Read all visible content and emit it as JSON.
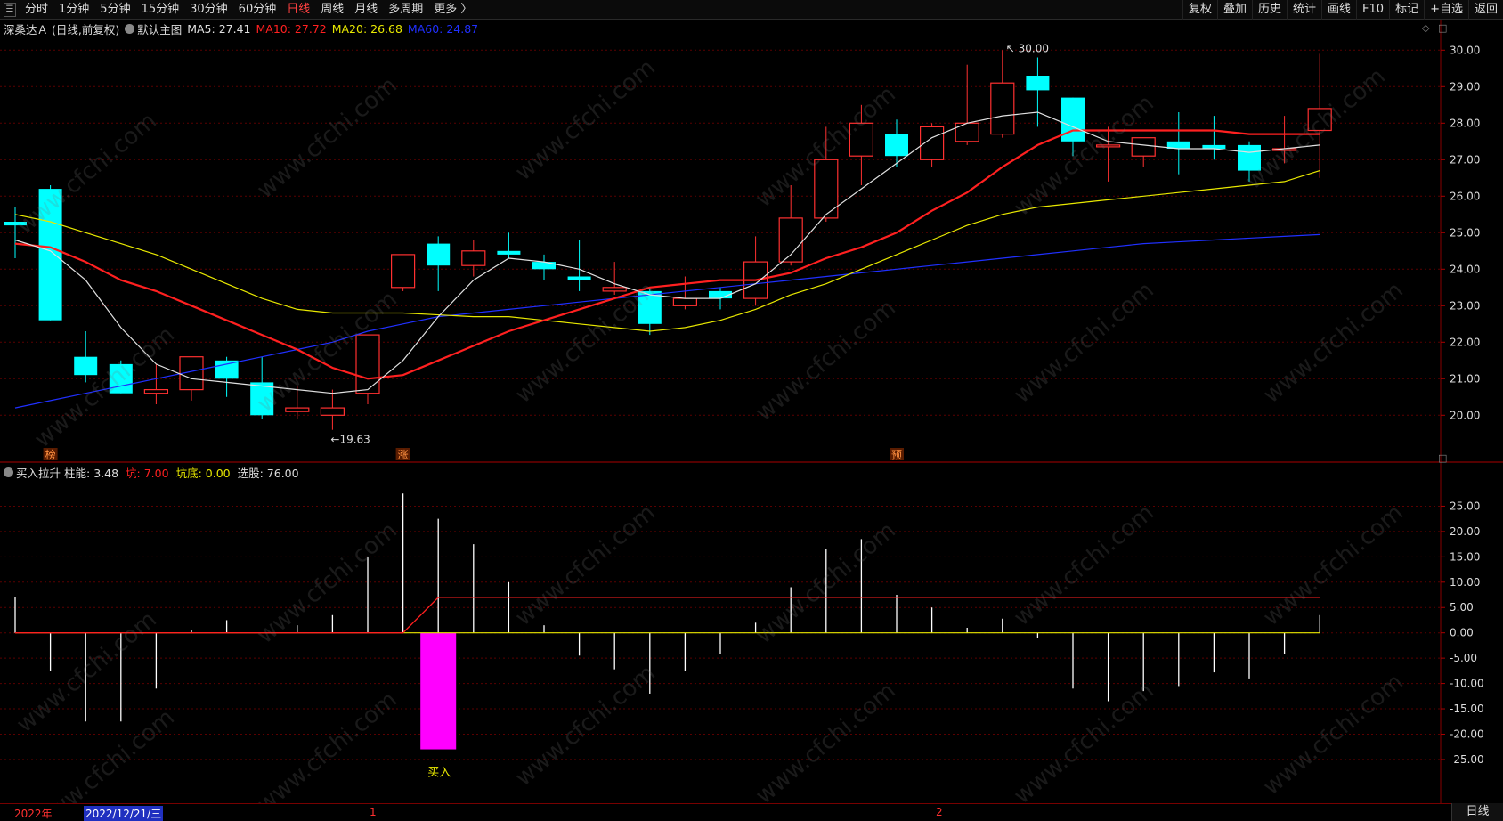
{
  "toolbar": {
    "menu_icon": "menu-icon",
    "periods": [
      "分时",
      "1分钟",
      "5分钟",
      "15分钟",
      "30分钟",
      "60分钟",
      "日线",
      "周线",
      "月线",
      "多周期",
      "更多 〉"
    ],
    "active_period": "日线",
    "right_buttons": [
      "复权",
      "叠加",
      "历史",
      "统计",
      "画线",
      "F10",
      "标记",
      "+自选",
      "返回"
    ]
  },
  "main_panel": {
    "stock": "深桑达Ａ (日线,前复权)",
    "template": "默认主图",
    "ma5_label": "MA5: 27.41",
    "ma10_label": "MA10: 27.72",
    "ma20_label": "MA20: 26.68",
    "ma60_label": "MA60: 24.87",
    "high_marker": "30.00",
    "low_marker": "19.63",
    "marks": [
      "榜",
      "涨",
      "预"
    ],
    "colors": {
      "up": "#ff3030",
      "down": "#00ffff",
      "ma5": "#e0e0e0",
      "ma10": "#ff2020",
      "ma20": "#e8e800",
      "ma60": "#2030ff"
    }
  },
  "sub_panel": {
    "indicator": "买入拉升",
    "zhuneng_label": "柱能: 3.48",
    "keng_label": "坑: 7.00",
    "kengdi_label": "坑底: 0.00",
    "xuangu_label": "选股: 76.00",
    "buy_label": "买入",
    "colors": {
      "bar": "#ffffff",
      "buy": "#ff00ff",
      "line_red": "#ff2020",
      "line_yellow": "#e8e800"
    }
  },
  "bottom": {
    "year_label": "2022年",
    "cursor_date": "2022/12/21/三",
    "month_labels": [
      "1",
      "2"
    ],
    "period_tag": "日线"
  },
  "watermark": "www.cfchi.com",
  "chart_data": [
    {
      "type": "candlestick",
      "yticks": [
        "30.00",
        "29.00",
        "28.00",
        "27.00",
        "26.00",
        "25.00",
        "24.00",
        "23.00",
        "22.00",
        "21.00",
        "20.00"
      ],
      "ylim": [
        19.3,
        30.3
      ],
      "candles": [
        {
          "o": 25.3,
          "h": 25.7,
          "l": 24.3,
          "c": 25.2
        },
        {
          "o": 26.2,
          "h": 26.3,
          "l": 22.6,
          "c": 22.6
        },
        {
          "o": 21.6,
          "h": 22.3,
          "l": 20.9,
          "c": 21.1
        },
        {
          "o": 21.4,
          "h": 21.5,
          "l": 20.6,
          "c": 20.6
        },
        {
          "o": 20.6,
          "h": 21.4,
          "l": 20.3,
          "c": 20.7
        },
        {
          "o": 20.7,
          "h": 21.6,
          "l": 20.4,
          "c": 21.6
        },
        {
          "o": 21.5,
          "h": 21.6,
          "l": 20.5,
          "c": 21.0
        },
        {
          "o": 20.9,
          "h": 21.6,
          "l": 19.9,
          "c": 20.0
        },
        {
          "o": 20.1,
          "h": 20.8,
          "l": 19.9,
          "c": 20.2
        },
        {
          "o": 20.0,
          "h": 20.7,
          "l": 19.6,
          "c": 20.2
        },
        {
          "o": 20.6,
          "h": 22.2,
          "l": 20.3,
          "c": 22.2
        },
        {
          "o": 23.5,
          "h": 24.4,
          "l": 23.4,
          "c": 24.4
        },
        {
          "o": 24.7,
          "h": 24.9,
          "l": 23.4,
          "c": 24.1
        },
        {
          "o": 24.1,
          "h": 24.8,
          "l": 23.8,
          "c": 24.5
        },
        {
          "o": 24.5,
          "h": 25.0,
          "l": 24.3,
          "c": 24.4
        },
        {
          "o": 24.2,
          "h": 24.4,
          "l": 23.7,
          "c": 24.0
        },
        {
          "o": 23.8,
          "h": 24.8,
          "l": 23.4,
          "c": 23.7
        },
        {
          "o": 23.4,
          "h": 24.2,
          "l": 23.3,
          "c": 23.5
        },
        {
          "o": 23.4,
          "h": 23.5,
          "l": 22.2,
          "c": 22.5
        },
        {
          "o": 23.0,
          "h": 23.8,
          "l": 22.9,
          "c": 23.2
        },
        {
          "o": 23.4,
          "h": 23.5,
          "l": 22.9,
          "c": 23.2
        },
        {
          "o": 23.2,
          "h": 24.9,
          "l": 23.0,
          "c": 24.2
        },
        {
          "o": 24.2,
          "h": 26.3,
          "l": 24.1,
          "c": 25.4
        },
        {
          "o": 25.4,
          "h": 27.9,
          "l": 25.3,
          "c": 27.0
        },
        {
          "o": 27.1,
          "h": 28.5,
          "l": 26.3,
          "c": 28.0
        },
        {
          "o": 27.7,
          "h": 28.1,
          "l": 26.8,
          "c": 27.1
        },
        {
          "o": 27.0,
          "h": 28.0,
          "l": 26.8,
          "c": 27.9
        },
        {
          "o": 27.5,
          "h": 29.6,
          "l": 27.4,
          "c": 28.0
        },
        {
          "o": 27.7,
          "h": 30.0,
          "l": 27.6,
          "c": 29.1
        },
        {
          "o": 29.3,
          "h": 29.8,
          "l": 27.9,
          "c": 28.9
        },
        {
          "o": 28.7,
          "h": 28.7,
          "l": 27.1,
          "c": 27.5
        },
        {
          "o": 27.4,
          "h": 27.9,
          "l": 26.4,
          "c": 27.4
        },
        {
          "o": 27.1,
          "h": 27.6,
          "l": 26.8,
          "c": 27.6
        },
        {
          "o": 27.5,
          "h": 28.3,
          "l": 26.6,
          "c": 27.3
        },
        {
          "o": 27.4,
          "h": 28.2,
          "l": 27.0,
          "c": 27.3
        },
        {
          "o": 27.4,
          "h": 27.5,
          "l": 26.4,
          "c": 26.7
        },
        {
          "o": 27.3,
          "h": 28.2,
          "l": 26.9,
          "c": 27.3
        },
        {
          "o": 27.8,
          "h": 29.9,
          "l": 26.5,
          "c": 28.4
        }
      ],
      "ma5": [
        24.8,
        24.5,
        23.7,
        22.4,
        21.4,
        21.0,
        20.9,
        20.8,
        20.7,
        20.6,
        20.7,
        21.5,
        22.7,
        23.7,
        24.3,
        24.2,
        24.0,
        23.6,
        23.3,
        23.2,
        23.2,
        23.6,
        24.4,
        25.5,
        26.2,
        26.9,
        27.6,
        28.0,
        28.2,
        28.3,
        27.9,
        27.5,
        27.4,
        27.3,
        27.3,
        27.2,
        27.3,
        27.4
      ],
      "ma10": [
        24.7,
        24.6,
        24.2,
        23.7,
        23.4,
        23.0,
        22.6,
        22.2,
        21.8,
        21.3,
        21.0,
        21.1,
        21.5,
        21.9,
        22.3,
        22.6,
        22.9,
        23.2,
        23.5,
        23.6,
        23.7,
        23.7,
        23.9,
        24.3,
        24.6,
        25.0,
        25.6,
        26.1,
        26.8,
        27.4,
        27.8,
        27.8,
        27.8,
        27.8,
        27.8,
        27.7,
        27.7,
        27.7
      ],
      "ma20": [
        25.5,
        25.3,
        25.0,
        24.7,
        24.4,
        24.0,
        23.6,
        23.2,
        22.9,
        22.8,
        22.8,
        22.8,
        22.75,
        22.7,
        22.7,
        22.6,
        22.5,
        22.4,
        22.3,
        22.4,
        22.6,
        22.9,
        23.3,
        23.6,
        24.0,
        24.4,
        24.8,
        25.2,
        25.5,
        25.7,
        25.8,
        25.9,
        26.0,
        26.1,
        26.2,
        26.3,
        26.4,
        26.7
      ],
      "ma60": [
        20.2,
        20.4,
        20.6,
        20.8,
        21.0,
        21.2,
        21.4,
        21.6,
        21.8,
        22.0,
        22.3,
        22.5,
        22.7,
        22.8,
        22.9,
        23.0,
        23.1,
        23.2,
        23.3,
        23.4,
        23.5,
        23.6,
        23.7,
        23.8,
        23.9,
        24.0,
        24.1,
        24.2,
        24.3,
        24.4,
        24.5,
        24.6,
        24.7,
        24.75,
        24.8,
        24.85,
        24.9,
        24.95
      ]
    },
    {
      "type": "bar",
      "yticks": [
        "25.00",
        "20.00",
        "15.00",
        "10.00",
        "5.00",
        "0.00",
        "-5.00",
        "-10.00",
        "-15.00",
        "-20.00",
        "-25.00"
      ],
      "ylim": [
        -28,
        30
      ],
      "values": [
        7,
        -7.5,
        -17.5,
        -17.5,
        -11,
        0.5,
        2.5,
        0,
        1.5,
        3.5,
        15,
        27.5,
        22.5,
        17.5,
        10,
        1.5,
        -4.5,
        -7.2,
        -12,
        -7.5,
        -4.2,
        2,
        9,
        16.5,
        18.5,
        7.5,
        5,
        1,
        2.8,
        -1,
        -11,
        -13.5,
        -11.5,
        -10.5,
        -7.8,
        -9,
        -4.2,
        3.5
      ],
      "buy_bar": {
        "index": 12,
        "value": -23
      },
      "red_line": [
        0,
        0,
        0,
        0,
        0,
        0,
        0,
        0,
        0,
        0,
        0,
        0,
        7,
        7,
        7,
        7,
        7,
        7,
        7,
        7,
        7,
        7,
        7,
        7,
        7,
        7,
        7,
        7,
        7,
        7,
        7,
        7,
        7,
        7,
        7,
        7,
        7,
        7
      ],
      "yellow_line": [
        0,
        0,
        0,
        0,
        0,
        0,
        0,
        0,
        0,
        0,
        0,
        0,
        0,
        0,
        0,
        0,
        0,
        0,
        0,
        0,
        0,
        0,
        0,
        0,
        0,
        0,
        0,
        0,
        0,
        0,
        0,
        0,
        0,
        0,
        0,
        0,
        0,
        0
      ]
    }
  ]
}
